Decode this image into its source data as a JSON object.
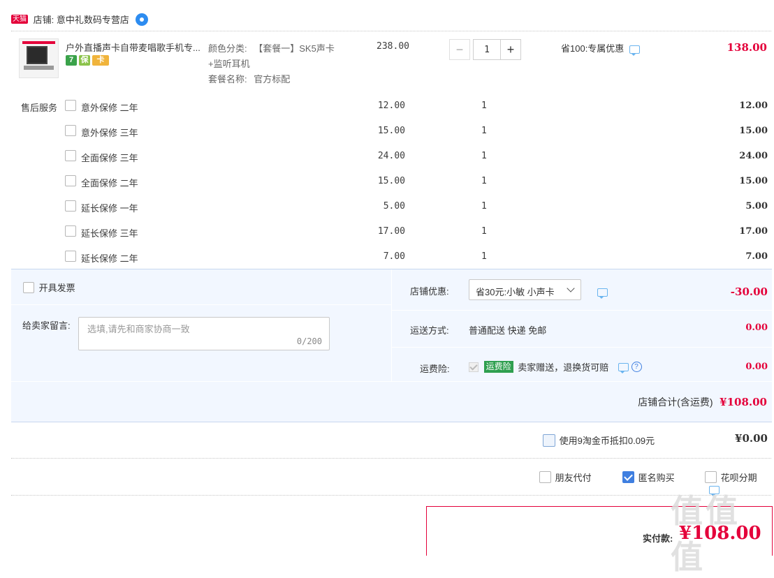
{
  "shop": {
    "badge": "天猫",
    "label": "店铺: 意中礼数码专营店"
  },
  "product": {
    "title": "户外直播声卡自带麦唱歌手机专...",
    "promo_icons": [
      {
        "name": "seven-day-return-icon",
        "text": "7",
        "color": "#3aa24a"
      },
      {
        "name": "guarantee-icon",
        "text": "保",
        "color": "#e2a21b"
      },
      {
        "name": "credit-card-icon",
        "text": "卡",
        "color": "#f0b43c"
      }
    ],
    "sku_color_label": "颜色分类:",
    "sku_color_value": "【套餐一】SK5声卡",
    "sku_color_value_line2": "+监听耳机",
    "sku_package_label": "套餐名称:",
    "sku_package_value": "官方标配",
    "unit_price": "238.00",
    "quantity": "1",
    "discount_text": "省100:专属优惠",
    "total": "138.00"
  },
  "after_sales": {
    "label": "售后服务",
    "items": [
      {
        "label": "意外保修 二年",
        "price": "12.00",
        "qty": "1",
        "total": "12.00"
      },
      {
        "label": "意外保修 三年",
        "price": "15.00",
        "qty": "1",
        "total": "15.00"
      },
      {
        "label": "全面保修 三年",
        "price": "24.00",
        "qty": "1",
        "total": "24.00"
      },
      {
        "label": "全面保修 二年",
        "price": "15.00",
        "qty": "1",
        "total": "15.00"
      },
      {
        "label": "延长保修 一年",
        "price": "5.00",
        "qty": "1",
        "total": "5.00"
      },
      {
        "label": "延长保修 三年",
        "price": "17.00",
        "qty": "1",
        "total": "17.00"
      },
      {
        "label": "延长保修 二年",
        "price": "7.00",
        "qty": "1",
        "total": "7.00"
      }
    ]
  },
  "invoice": {
    "label": "开具发票"
  },
  "message": {
    "label": "给卖家留言:",
    "placeholder": "选填,请先和商家协商一致",
    "count": "0/200"
  },
  "shop_discount": {
    "label": "店铺优惠:",
    "selected": "省30元:小敏 小声卡",
    "amount": "-30.00"
  },
  "shipping": {
    "label": "运送方式:",
    "value": "普通配送 快递 免邮",
    "amount": "0.00"
  },
  "freight_insurance": {
    "label": "运费险:",
    "tag": "运费险",
    "value": "卖家赠送，退换货可赔",
    "amount": "0.00"
  },
  "shop_total": {
    "label": "店铺合计(含运费)",
    "amount": "¥108.00"
  },
  "taobao_coin": {
    "label": "使用9淘金币抵扣0.09元",
    "amount": "¥0.00"
  },
  "options": {
    "friend_pay": "朋友代付",
    "anonymous": "匿名购买",
    "huabei": "花呗分期"
  },
  "payment": {
    "label": "实付款:",
    "amount": "¥108.00"
  },
  "watermark": "值值值"
}
